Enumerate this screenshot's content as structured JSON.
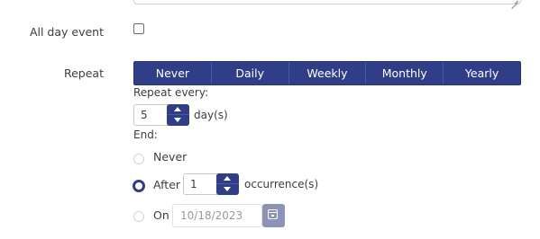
{
  "form": {
    "all_day": {
      "label": "All day event",
      "checked": false
    },
    "repeat": {
      "label": "Repeat",
      "options": [
        "Never",
        "Daily",
        "Weekly",
        "Monthly",
        "Yearly"
      ]
    },
    "repeat_every": {
      "label": "Repeat every:",
      "value": "5",
      "unit": "day(s)"
    },
    "end": {
      "label": "End:",
      "selected": "After",
      "never_label": "Never",
      "after_label": "After",
      "after_value": "1",
      "after_unit": "occurrence(s)",
      "on_label": "On",
      "on_date": "10/18/2023"
    }
  },
  "icons": {
    "calendar": "calendar-icon",
    "spinner_up": "chevron-up-icon",
    "spinner_down": "chevron-down-icon",
    "resize": "resize-grip-icon"
  },
  "colors": {
    "accent": "#2f3e87",
    "accent_disabled": "#8d93b7",
    "text": "#3d3d3d",
    "muted": "#9a9a9a"
  }
}
